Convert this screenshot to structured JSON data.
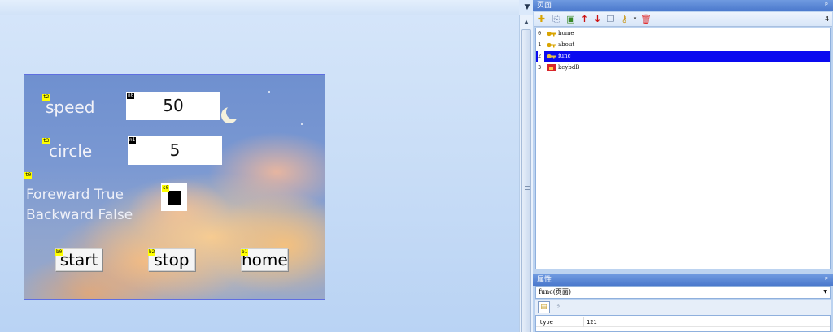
{
  "canvas": {
    "dropdown_icon": "triangle-down-icon",
    "screen": {
      "labels": {
        "speed_tag": "t2",
        "speed": "speed",
        "circle_tag": "t3",
        "circle": "circle",
        "dir_tag": "t0",
        "dir_line1": "Foreward True",
        "dir_line2": "Backward False"
      },
      "inputs": {
        "speed_tag": "n0",
        "speed_value": "50",
        "circle_tag": "n1",
        "circle_value": "5"
      },
      "dual_state": {
        "tag": "s0"
      },
      "buttons": {
        "start_tag": "b0",
        "start": "start",
        "stop_tag": "b2",
        "stop": "stop",
        "home_tag": "b1",
        "home": "home"
      }
    }
  },
  "pages_panel": {
    "title": "页面",
    "count": "4",
    "pin": "ᵖ",
    "toolbar_icons": [
      "add-page-icon",
      "import-page-icon",
      "export-page-icon",
      "move-up-icon",
      "move-down-icon",
      "copy-page-icon",
      "key-icon",
      "delete-icon"
    ],
    "items": [
      {
        "index": "0",
        "name": "home",
        "icon": "key-icon"
      },
      {
        "index": "1",
        "name": "about",
        "icon": "key-icon"
      },
      {
        "index": "2",
        "name": "func",
        "icon": "key-icon"
      },
      {
        "index": "3",
        "name": "keybdB",
        "icon": "lock-icon"
      }
    ],
    "selected_index": 2
  },
  "props_panel": {
    "title": "属性",
    "pin": "ᵖ",
    "selected": "func(页面)",
    "rows": [
      {
        "key": "type",
        "value": "121"
      }
    ]
  }
}
